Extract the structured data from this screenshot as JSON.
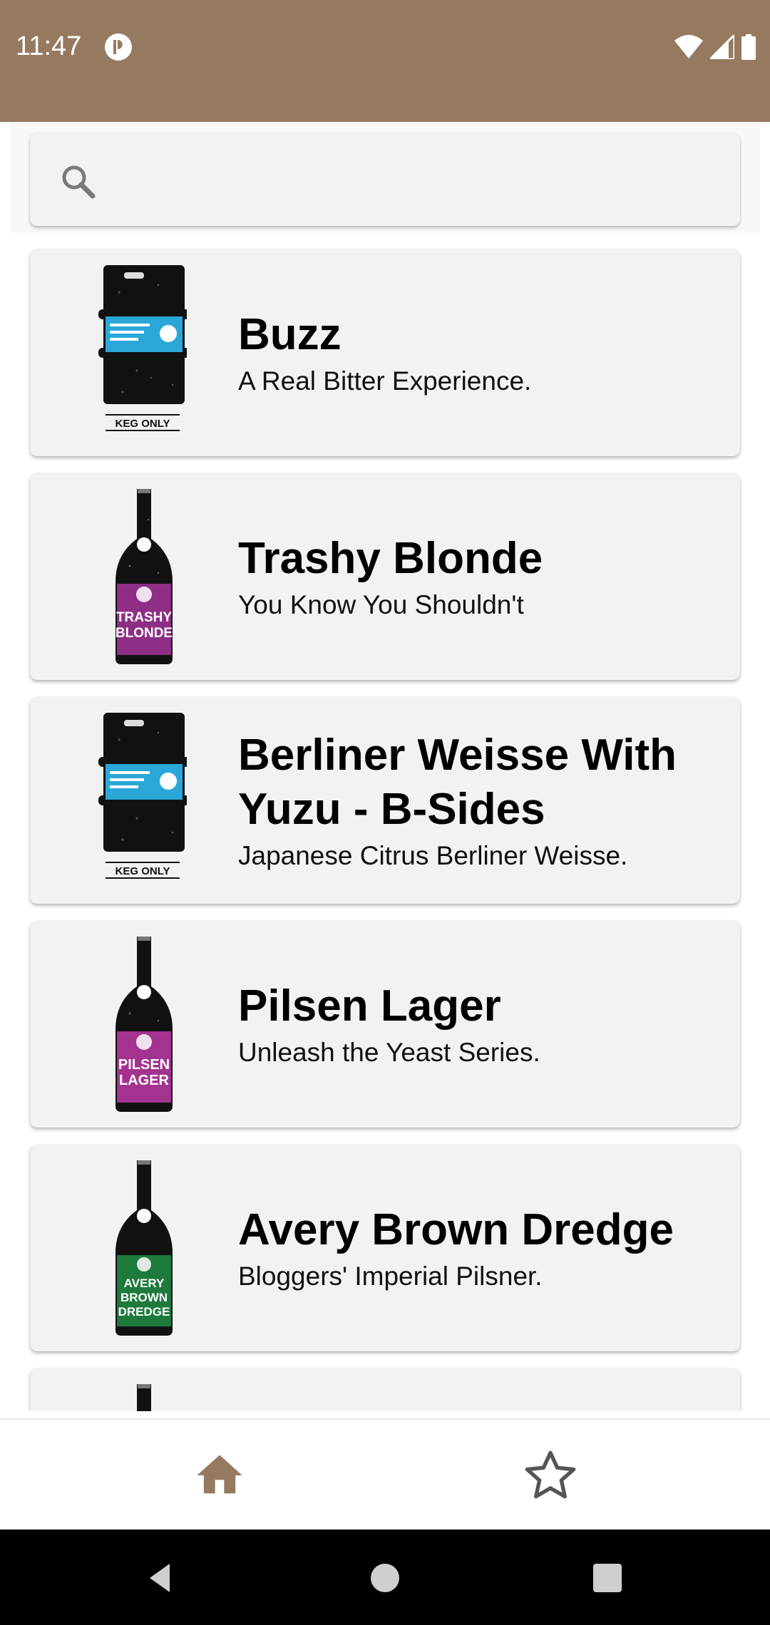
{
  "status_bar": {
    "time": "11:47",
    "background_color": "#957a60",
    "app_icon": "app-notification-icon",
    "icons": [
      "wifi-icon",
      "cell-signal-icon",
      "battery-icon"
    ]
  },
  "search": {
    "placeholder": "",
    "value": "",
    "icon": "search-icon"
  },
  "beers": [
    {
      "name": "Buzz",
      "tagline": "A Real Bitter Experience.",
      "image": "keg",
      "label_color": "#2aa7d8",
      "keg_text": "KEG ONLY"
    },
    {
      "name": "Trashy Blonde",
      "tagline": "You Know You Shouldn't",
      "image": "bottle",
      "label_color": "#8e2f85",
      "label_text": "TRASHY BLONDE"
    },
    {
      "name": "Berliner Weisse With Yuzu - B-Sides",
      "tagline": "Japanese Citrus Berliner Weisse.",
      "image": "keg",
      "label_color": "#2aa7d8",
      "keg_text": "KEG ONLY"
    },
    {
      "name": "Pilsen Lager",
      "tagline": "Unleash the Yeast Series.",
      "image": "bottle",
      "label_color": "#a3338e",
      "label_text": "PILSEN LAGER"
    },
    {
      "name": "Avery Brown Dredge",
      "tagline": "Bloggers' Imperial Pilsner.",
      "image": "bottle",
      "label_color": "#1e7a3c",
      "label_text": "AVERY BROWN DREDGE"
    }
  ],
  "bottom_nav": {
    "items": [
      {
        "icon": "home-icon",
        "active": true,
        "color": "#957a60"
      },
      {
        "icon": "star-outline-icon",
        "active": false,
        "color": "#555555"
      }
    ]
  },
  "system_nav": [
    "back-icon",
    "home-circle-icon",
    "recents-square-icon"
  ]
}
